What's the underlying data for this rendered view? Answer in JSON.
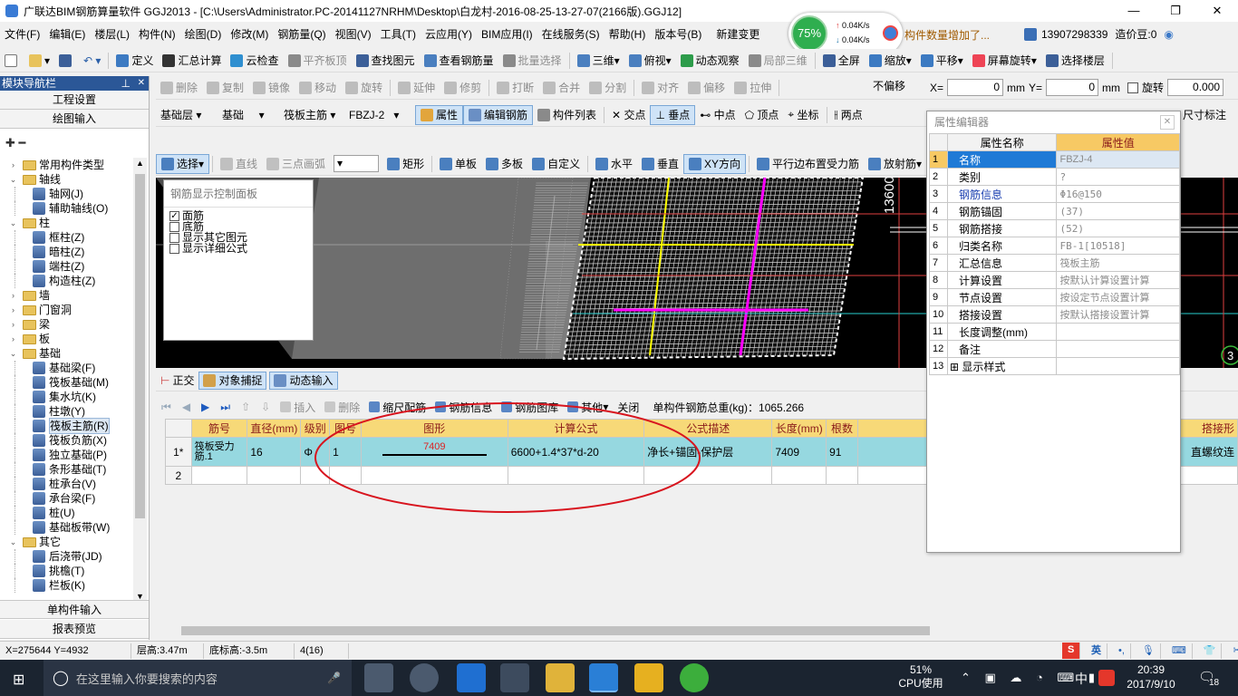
{
  "window": {
    "title": "广联达BIM钢筋算量软件 GGJ2013 - [C:\\Users\\Administrator.PC-20141127NRHM\\Desktop\\白龙村-2016-08-25-13-27-07(2166版).GGJ12]"
  },
  "net_widget": {
    "percent": "75%",
    "up": "0.04K/s",
    "down": "0.04K/s"
  },
  "ad_text": "构件数量增加了...",
  "account": {
    "phone": "13907298339",
    "cost_bean": "造价豆:0"
  },
  "menu": [
    "文件(F)",
    "编辑(E)",
    "楼层(L)",
    "构件(N)",
    "绘图(D)",
    "修改(M)",
    "钢筋量(Q)",
    "视图(V)",
    "工具(T)",
    "云应用(Y)",
    "BIM应用(I)",
    "在线服务(S)",
    "帮助(H)",
    "版本号(B)",
    "新建变更"
  ],
  "toolbar1": [
    "定义",
    "汇总计算",
    "云检查",
    "平齐板顶",
    "查找图元",
    "查看钢筋量",
    "批量选择",
    "三维",
    "俯视",
    "动态观察",
    "局部三维",
    "全屏",
    "缩放",
    "平移",
    "屏幕旋转",
    "选择楼层"
  ],
  "toolbar2": {
    "items": [
      "删除",
      "复制",
      "镜像",
      "移动",
      "旋转",
      "延伸",
      "修剪",
      "打断",
      "合并",
      "分割",
      "对齐",
      "偏移",
      "拉伸"
    ],
    "offset": "不偏移",
    "x_label": "X=",
    "x_value": "0",
    "y_label": "Y=",
    "y_value": "0",
    "unit": "mm",
    "rotate_label": "旋转",
    "rotate_value": "0.000"
  },
  "toolbar3": {
    "floor": "基础层",
    "category": "基础",
    "type": "筏板主筋",
    "code": "FBZJ-2",
    "buttons": [
      "属性",
      "编辑钢筋",
      "构件列表",
      "交点",
      "垂点",
      "中点",
      "顶点",
      "坐标",
      "两点"
    ],
    "dim": "尺寸标注"
  },
  "toolbar4": [
    "选择",
    "直线",
    "三点画弧",
    "矩形",
    "单板",
    "多板",
    "自定义",
    "水平",
    "垂直",
    "XY方向",
    "平行边布置受力筋",
    "放射筋"
  ],
  "nav": {
    "title": "模块导航栏",
    "btn_engineering": "工程设置",
    "btn_drawing": "绘图输入",
    "btn_single": "单构件输入",
    "btn_report": "报表预览",
    "tree": [
      {
        "level": 0,
        "exp": "›",
        "kind": "folder",
        "label": "常用构件类型"
      },
      {
        "level": 0,
        "exp": "⌄",
        "kind": "folder",
        "label": "轴线"
      },
      {
        "level": 1,
        "label": "轴网(J)"
      },
      {
        "level": 1,
        "label": "辅助轴线(O)"
      },
      {
        "level": 0,
        "exp": "⌄",
        "kind": "folder",
        "label": "柱"
      },
      {
        "level": 1,
        "label": "框柱(Z)"
      },
      {
        "level": 1,
        "label": "暗柱(Z)"
      },
      {
        "level": 1,
        "label": "端柱(Z)"
      },
      {
        "level": 1,
        "label": "构造柱(Z)"
      },
      {
        "level": 0,
        "exp": "›",
        "kind": "folder",
        "label": "墙"
      },
      {
        "level": 0,
        "exp": "›",
        "kind": "folder",
        "label": "门窗洞"
      },
      {
        "level": 0,
        "exp": "›",
        "kind": "folder",
        "label": "梁"
      },
      {
        "level": 0,
        "exp": "›",
        "kind": "folder",
        "label": "板"
      },
      {
        "level": 0,
        "exp": "⌄",
        "kind": "folder",
        "label": "基础"
      },
      {
        "level": 1,
        "label": "基础梁(F)"
      },
      {
        "level": 1,
        "label": "筏板基础(M)"
      },
      {
        "level": 1,
        "label": "集水坑(K)"
      },
      {
        "level": 1,
        "label": "柱墩(Y)"
      },
      {
        "level": 1,
        "label": "筏板主筋(R)",
        "selected": true
      },
      {
        "level": 1,
        "label": "筏板负筋(X)"
      },
      {
        "level": 1,
        "label": "独立基础(P)"
      },
      {
        "level": 1,
        "label": "条形基础(T)"
      },
      {
        "level": 1,
        "label": "桩承台(V)"
      },
      {
        "level": 1,
        "label": "承台梁(F)"
      },
      {
        "level": 1,
        "label": "桩(U)"
      },
      {
        "level": 1,
        "label": "基础板带(W)"
      },
      {
        "level": 0,
        "exp": "⌄",
        "kind": "folder",
        "label": "其它"
      },
      {
        "level": 1,
        "label": "后浇带(JD)"
      },
      {
        "level": 1,
        "label": "挑檐(T)"
      },
      {
        "level": 1,
        "label": "栏板(K)"
      }
    ]
  },
  "rebar_panel": {
    "title": "钢筋显示控制面板",
    "items": [
      {
        "label": "面筋",
        "checked": true
      },
      {
        "label": "底筋",
        "checked": false
      },
      {
        "label": "显示其它图元",
        "checked": false
      },
      {
        "label": "显示详细公式",
        "checked": false
      }
    ]
  },
  "canvas": {
    "dim_label": "13600",
    "grid_number": "3"
  },
  "snap_bar": [
    "正交",
    "对象捕捉",
    "动态输入"
  ],
  "rebar_toolbar": {
    "items": [
      "插入",
      "删除",
      "缩尺配筋",
      "钢筋信息",
      "钢筋图库",
      "其他",
      "关闭"
    ],
    "total": "单构件钢筋总重(kg)：1065.266"
  },
  "rebar_table": {
    "headers": [
      "筋号",
      "直径(mm)",
      "级别",
      "图号",
      "图形",
      "计算公式",
      "公式描述",
      "长度(mm)",
      "根数",
      "搭接形"
    ],
    "rows": [
      {
        "num": "1*",
        "name": "筏板受力筋.1",
        "dia": "16",
        "grade": "Φ",
        "fig": "1",
        "shape": "7409",
        "formula": "6600+1.4*37*d-20",
        "desc": "净长+锚固-保护层",
        "length": "7409",
        "count": "91",
        "lap": "直螺纹连"
      },
      {
        "num": "2",
        "name": "",
        "dia": "",
        "grade": "",
        "fig": "",
        "shape": "",
        "formula": "",
        "desc": "",
        "length": "",
        "count": "",
        "lap": ""
      }
    ]
  },
  "prop": {
    "title": "属性编辑器",
    "headers": [
      "属性名称",
      "属性值"
    ],
    "rows": [
      {
        "n": "1",
        "name": "名称",
        "value": "FBZJ-4",
        "blue": true
      },
      {
        "n": "2",
        "name": "类别",
        "value": "?",
        "blue": false
      },
      {
        "n": "3",
        "name": "钢筋信息",
        "value": "Φ16@150",
        "blue": true
      },
      {
        "n": "4",
        "name": "钢筋锚固",
        "value": "(37)",
        "blue": false
      },
      {
        "n": "5",
        "name": "钢筋搭接",
        "value": "(52)",
        "blue": false
      },
      {
        "n": "6",
        "name": "归类名称",
        "value": "FB-1[10518]",
        "blue": false
      },
      {
        "n": "7",
        "name": "汇总信息",
        "value": "筏板主筋",
        "blue": false
      },
      {
        "n": "8",
        "name": "计算设置",
        "value": "按默认计算设置计算",
        "blue": false
      },
      {
        "n": "9",
        "name": "节点设置",
        "value": "按设定节点设置计算",
        "blue": false
      },
      {
        "n": "10",
        "name": "搭接设置",
        "value": "按默认搭接设置计算",
        "blue": false
      },
      {
        "n": "11",
        "name": "长度调整(mm)",
        "value": "",
        "blue": false
      },
      {
        "n": "12",
        "name": "备注",
        "value": "",
        "blue": false
      },
      {
        "n": "13",
        "name": "显示样式",
        "value": "",
        "blue": false,
        "plus": true
      }
    ]
  },
  "status": {
    "coords": "X=275644 Y=4932",
    "floor_height": "层高:3.47m",
    "bottom_elev": "底标高:-3.5m",
    "count": "4(16)"
  },
  "taskbar": {
    "search": "在这里输入你要搜索的内容",
    "cpu_pct": "51%",
    "cpu_label": "CPU使用",
    "ime": "中",
    "time": "20:39",
    "date": "2017/9/10",
    "notif": "18"
  },
  "tray_ime": "英"
}
